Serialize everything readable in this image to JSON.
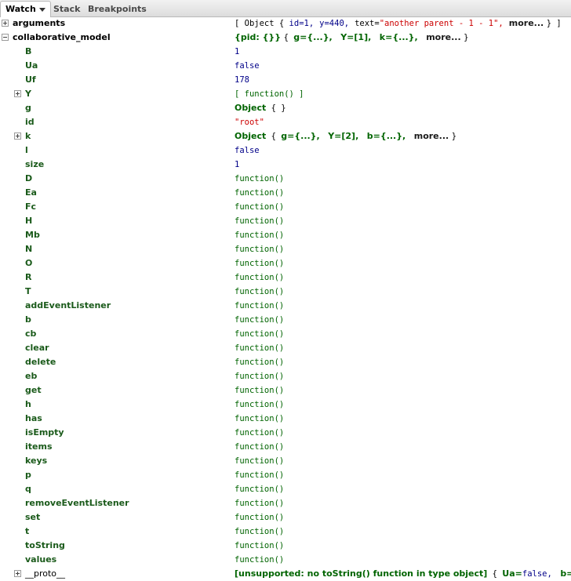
{
  "tabs": [
    {
      "label": "Watch",
      "active": true
    },
    {
      "label": "Stack",
      "active": false
    },
    {
      "label": "Breakpoints",
      "active": false
    }
  ],
  "rows": {
    "arguments": {
      "name": "arguments",
      "v_open": "[ Object { ",
      "v_id": "id=1,",
      "v_y": "y=440,",
      "v_text_key": "text=",
      "v_text_val": "\"another parent - 1 - 1\",",
      "v_more": "more...",
      "v_close": "} ]"
    },
    "collaborative_model": {
      "name": "collaborative_model",
      "v_pid": "{pid: {}}",
      "v_brace": "{ ",
      "v_g": "g={...},",
      "v_Y": "Y=[1],",
      "v_k": "k={...},",
      "v_more": "more...",
      "v_close": "}"
    },
    "B": {
      "name": "B",
      "value": "1"
    },
    "Ua": {
      "name": "Ua",
      "value": "false"
    },
    "Uf": {
      "name": "Uf",
      "value": "178"
    },
    "Y": {
      "name": "Y",
      "value": "[ function() ]"
    },
    "g": {
      "name": "g",
      "v_obj": "Object",
      "v_rest": " {  }"
    },
    "id": {
      "name": "id",
      "value": "\"root\""
    },
    "k": {
      "name": "k",
      "v_obj": "Object",
      "v_brace": " { ",
      "v_g": "g={...},",
      "v_Y": "Y=[2],",
      "v_b": "b={...},",
      "v_more": "more...",
      "v_close": "}"
    },
    "l": {
      "name": "l",
      "value": "false"
    },
    "size": {
      "name": "size",
      "value": "1"
    },
    "functions": [
      {
        "name": "D",
        "value": "function()"
      },
      {
        "name": "Ea",
        "value": "function()"
      },
      {
        "name": "Fc",
        "value": "function()"
      },
      {
        "name": "H",
        "value": "function()"
      },
      {
        "name": "Mb",
        "value": "function()"
      },
      {
        "name": "N",
        "value": "function()"
      },
      {
        "name": "O",
        "value": "function()"
      },
      {
        "name": "R",
        "value": "function()"
      },
      {
        "name": "T",
        "value": "function()"
      },
      {
        "name": "addEventListener",
        "value": "function()"
      },
      {
        "name": "b",
        "value": "function()"
      },
      {
        "name": "cb",
        "value": "function()"
      },
      {
        "name": "clear",
        "value": "function()"
      },
      {
        "name": "delete",
        "value": "function()"
      },
      {
        "name": "eb",
        "value": "function()"
      },
      {
        "name": "get",
        "value": "function()"
      },
      {
        "name": "h",
        "value": "function()"
      },
      {
        "name": "has",
        "value": "function()"
      },
      {
        "name": "isEmpty",
        "value": "function()"
      },
      {
        "name": "items",
        "value": "function()"
      },
      {
        "name": "keys",
        "value": "function()"
      },
      {
        "name": "p",
        "value": "function()"
      },
      {
        "name": "q",
        "value": "function()"
      },
      {
        "name": "removeEventListener",
        "value": "function()"
      },
      {
        "name": "set",
        "value": "function()"
      },
      {
        "name": "t",
        "value": "function()"
      },
      {
        "name": "toString",
        "value": "function()"
      },
      {
        "name": "values",
        "value": "function()"
      }
    ],
    "proto": {
      "name": "__proto__",
      "v_unsupported": "[unsupported: no toString() function in type object]",
      "v_brace": " { ",
      "v_ua_key": "Ua=",
      "v_ua_val": "false,",
      "v_b": "b=function"
    }
  }
}
